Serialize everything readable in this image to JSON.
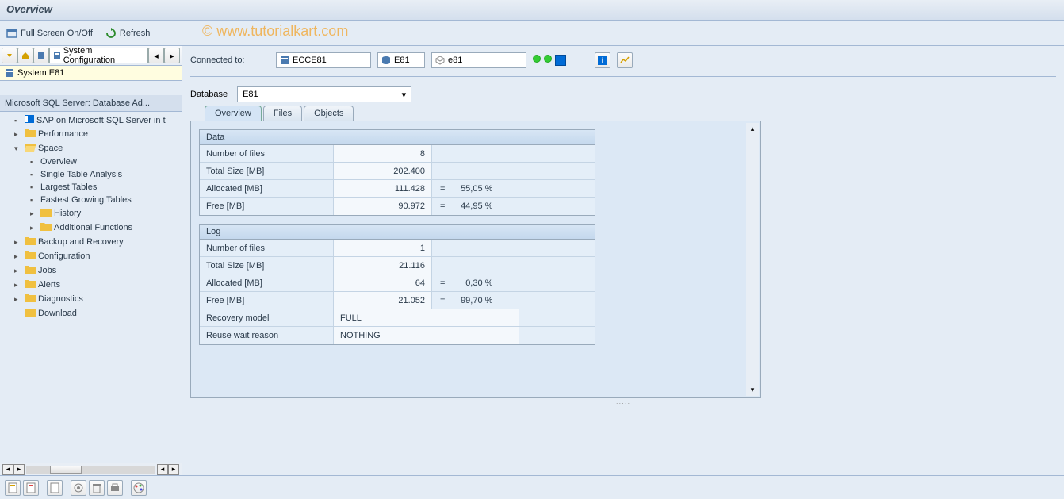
{
  "title": "Overview",
  "toolbar": {
    "fullscreen": "Full Screen On/Off",
    "refresh": "Refresh"
  },
  "watermark": "© www.tutorialkart.com",
  "sidebar": {
    "config_label": "System Configuration",
    "system_label": "System E81",
    "header": "Microsoft SQL Server: Database Ad...",
    "tree": {
      "sap_node": "SAP on Microsoft SQL Server in t",
      "performance": "Performance",
      "space": "Space",
      "space_children": {
        "overview": "Overview",
        "single_table": "Single Table Analysis",
        "largest": "Largest Tables",
        "fastest": "Fastest Growing Tables",
        "history": "History",
        "additional": "Additional Functions"
      },
      "backup": "Backup and Recovery",
      "configuration": "Configuration",
      "jobs": "Jobs",
      "alerts": "Alerts",
      "diagnostics": "Diagnostics",
      "download": "Download"
    }
  },
  "connection": {
    "label": "Connected to:",
    "server": "ECCE81",
    "db": "E81",
    "schema": "e81"
  },
  "database": {
    "label": "Database",
    "value": "E81"
  },
  "tabs": {
    "overview": "Overview",
    "files": "Files",
    "objects": "Objects"
  },
  "data_group": {
    "title": "Data",
    "rows": {
      "num_files_label": "Number of files",
      "num_files_value": "8",
      "total_size_label": "Total Size [MB]",
      "total_size_value": "202.400",
      "allocated_label": "Allocated [MB]",
      "allocated_value": "111.428",
      "allocated_eq": "=",
      "allocated_pct": "55,05 %",
      "free_label": "Free [MB]",
      "free_value": "90.972",
      "free_eq": "=",
      "free_pct": "44,95 %"
    }
  },
  "log_group": {
    "title": "Log",
    "rows": {
      "num_files_label": "Number of files",
      "num_files_value": "1",
      "total_size_label": "Total Size [MB]",
      "total_size_value": "21.116",
      "allocated_label": "Allocated [MB]",
      "allocated_value": "64",
      "allocated_eq": "=",
      "allocated_pct": "0,30 %",
      "free_label": "Free [MB]",
      "free_value": "21.052",
      "free_eq": "=",
      "free_pct": "99,70 %",
      "recovery_label": "Recovery model",
      "recovery_value": "FULL",
      "reuse_label": "Reuse wait reason",
      "reuse_value": "NOTHING"
    }
  }
}
